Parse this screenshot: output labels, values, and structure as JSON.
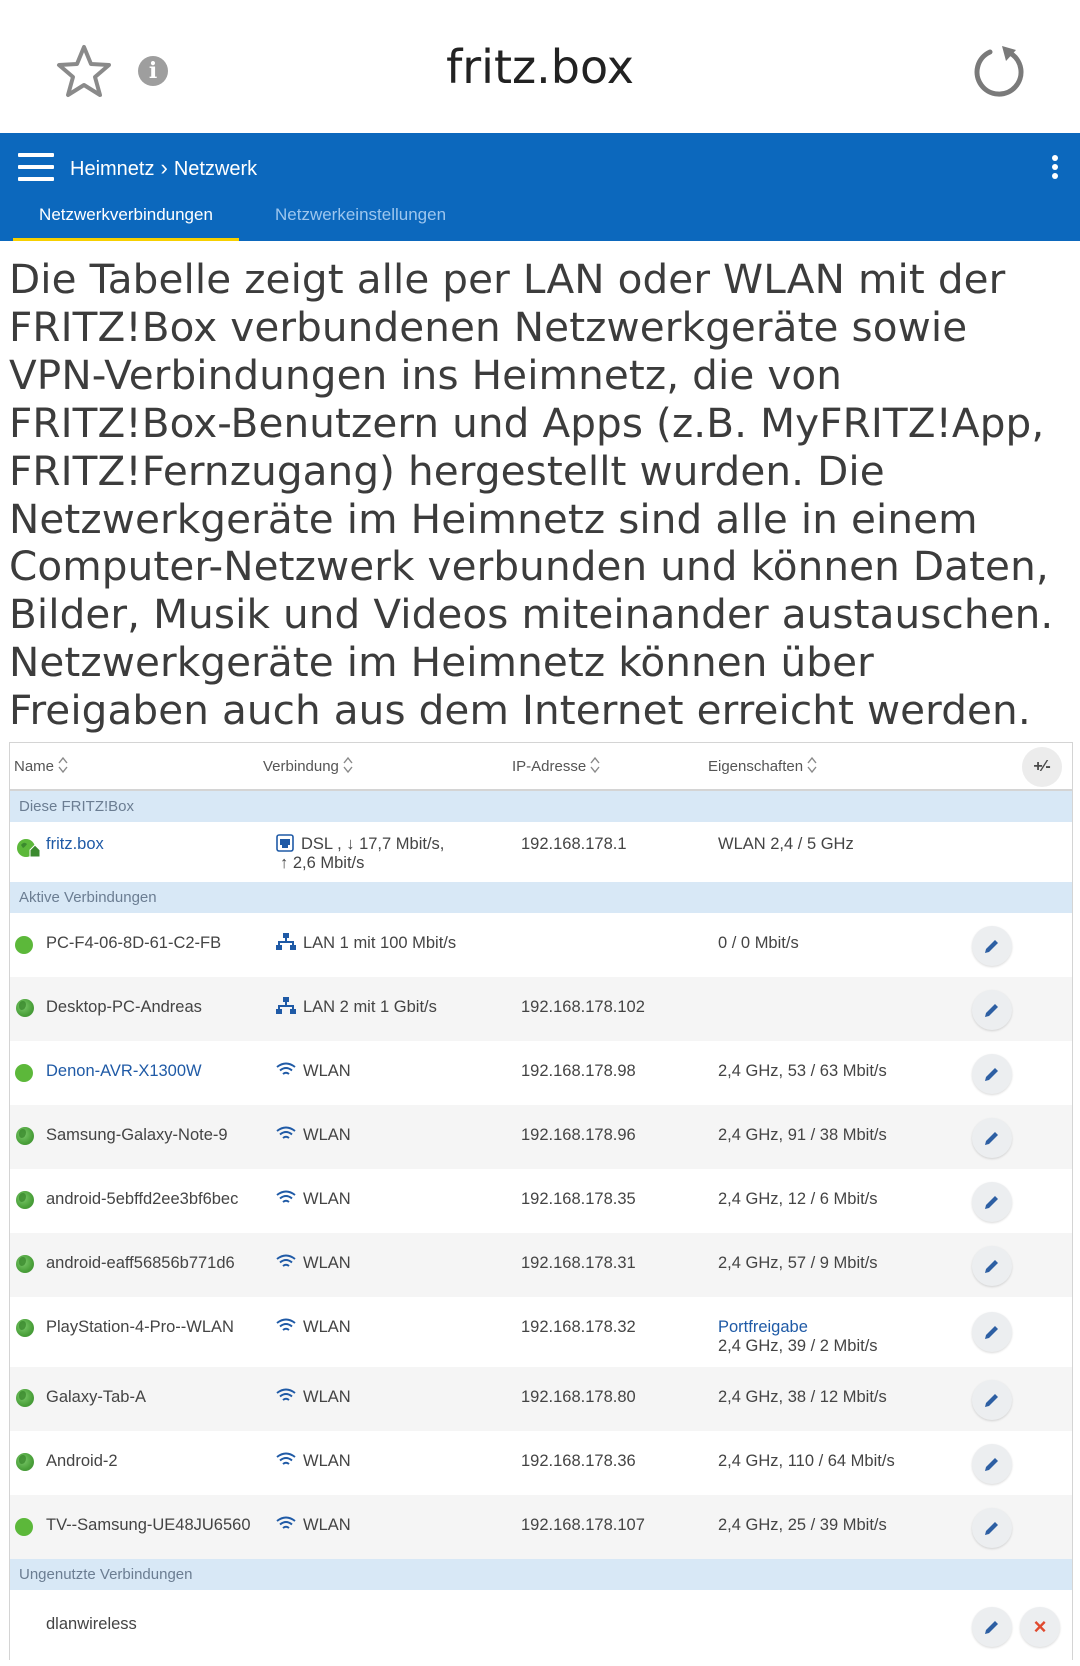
{
  "browser": {
    "url": "fritz.box",
    "icons": [
      "star-icon",
      "info-icon",
      "reload-icon"
    ]
  },
  "header": {
    "breadcrumb": [
      "Heimnetz",
      "Netzwerk"
    ],
    "tabs": [
      {
        "label": "Netzwerkverbindungen",
        "active": true
      },
      {
        "label": "Netzwerkeinstellungen",
        "active": false
      }
    ],
    "accent_color": "#0c68bd",
    "tab_indicator_color": "#f7d000"
  },
  "description": "Die Tabelle zeigt alle per LAN oder WLAN mit der FRITZ!Box verbundenen Netzwerkgeräte sowie VPN-Verbindungen ins Heimnetz, die von FRITZ!Box-Benutzern und Apps (z.B. MyFRITZ!App, FRITZ!Fernzugang) hergestellt wurden. Die Netzwerkgeräte im Heimnetz sind alle in einem Computer-Netzwerk verbunden und können Daten, Bilder, Musik und Videos miteinander austauschen. Netzwerkgeräte im Heimnetz können über Freigaben auch aus dem Internet erreicht werden.",
  "table": {
    "columns": [
      "Name",
      "Verbindung",
      "IP-Adresse",
      "Eigenschaften"
    ],
    "toggle_label": "+⁄-",
    "sections": {
      "box": "Diese FRITZ!Box",
      "active": "Aktive Verbindungen",
      "unused": "Ungenutzte Verbindungen"
    },
    "box_row": {
      "name": "fritz.box",
      "connection_line1": "DSL , ↓ 17,7 Mbit/s,",
      "connection_line2": "↑ 2,6 Mbit/s",
      "ip": "192.168.178.1",
      "properties": "WLAN 2,4 / 5 GHz"
    },
    "active_rows": [
      {
        "name": "PC-F4-06-8D-61-C2-FB",
        "connection": "LAN 1 mit 100 Mbit/s",
        "ip": "",
        "properties": "0 / 0 Mbit/s"
      },
      {
        "name": "Desktop-PC-Andreas",
        "connection": "LAN 2 mit 1 Gbit/s",
        "ip": "192.168.178.102",
        "properties": ""
      },
      {
        "name": "Denon-AVR-X1300W",
        "connection": "WLAN",
        "ip": "192.168.178.98",
        "properties": "2,4 GHz, 53 / 63 Mbit/s"
      },
      {
        "name": "Samsung-Galaxy-Note-9",
        "connection": "WLAN",
        "ip": "192.168.178.96",
        "properties": "2,4 GHz, 91 / 38 Mbit/s"
      },
      {
        "name": "android-5ebffd2ee3bf6bec",
        "connection": "WLAN",
        "ip": "192.168.178.35",
        "properties": "2,4 GHz, 12 / 6 Mbit/s"
      },
      {
        "name": "android-eaff56856b771d6",
        "connection": "WLAN",
        "ip": "192.168.178.31",
        "properties": "2,4 GHz, 57 / 9 Mbit/s"
      },
      {
        "name": "PlayStation-4-Pro--WLAN",
        "connection": "WLAN",
        "ip": "192.168.178.32",
        "properties_link": "Portfreigabe",
        "properties": "2,4 GHz, 39 / 2 Mbit/s"
      },
      {
        "name": "Galaxy-Tab-A",
        "connection": "WLAN",
        "ip": "192.168.178.80",
        "properties": "2,4 GHz, 38 / 12 Mbit/s"
      },
      {
        "name": "Android-2",
        "connection": "WLAN",
        "ip": "192.168.178.36",
        "properties": "2,4 GHz, 110 / 64 Mbit/s"
      },
      {
        "name": "TV--Samsung-UE48JU6560",
        "connection": "WLAN",
        "ip": "192.168.178.107",
        "properties": "2,4 GHz, 25 / 39 Mbit/s"
      }
    ],
    "unused_rows": [
      {
        "name": "dlanwireless"
      }
    ]
  }
}
